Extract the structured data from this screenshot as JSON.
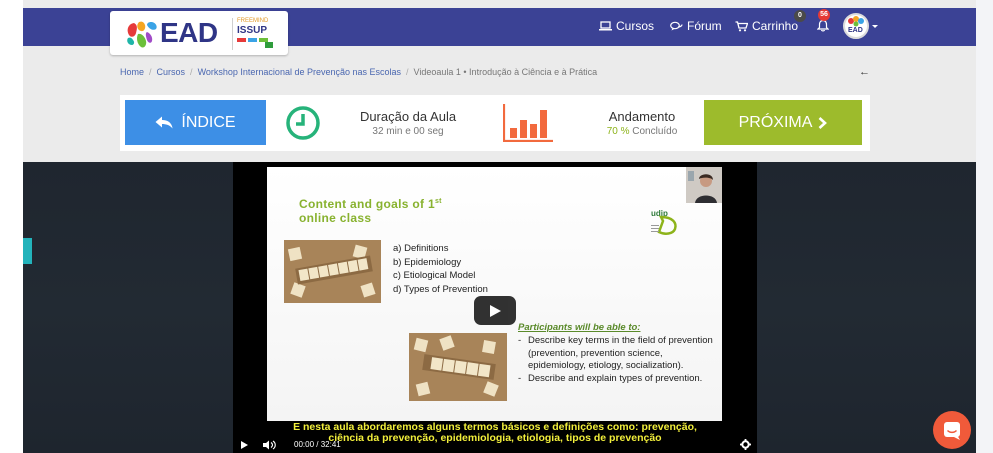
{
  "brand": {
    "logo_text": "EAD",
    "partner_line1": "FREEMIND",
    "partner_line2": "ISSUP"
  },
  "nav": {
    "cursos": "Cursos",
    "forum": "Fórum",
    "carrinho": "Carrinho",
    "cart_count": "0",
    "notification_count": "56",
    "avatar_text": "EAD"
  },
  "breadcrumb": {
    "home": "Home",
    "cursos": "Cursos",
    "workshop": "Workshop Internacional de Prevenção nas Escolas",
    "current": "Videoaula 1 • Introdução à Ciência e à Prática"
  },
  "lesson": {
    "indice_label": "ÍNDICE",
    "duration_title": "Duração da Aula",
    "duration_value": "32 min e 00 seg",
    "progress_title": "Andamento",
    "progress_pct": "70 %",
    "progress_suffix": " Concluído",
    "progress_fraction": 0.7,
    "next_label": "PRÓXIMA"
  },
  "slide": {
    "title_line1": "Content and goals of 1",
    "title_sup": "st",
    "title_line2": "online class",
    "list": [
      "a) Definitions",
      "b) Epidemiology",
      "c) Etiological Model",
      "d) Types of Prevention"
    ],
    "participants_title": "Participants will be able to:",
    "goals": [
      "Describe key terms in the field of prevention (prevention, prevention science, epidemiology, etiology, socialization).",
      "Describe and explain types of prevention."
    ]
  },
  "player": {
    "subtitle_line1": "E nesta aula abordaremos alguns termos básicos e definições como: prevenção,",
    "subtitle_line2": "ciência da prevenção, epidemiologia, etiologia, tipos de prevenção",
    "time_current": "00:00",
    "time_total": "32:41"
  },
  "colors": {
    "navbar": "#3b4295",
    "indice_button": "#3d8fe6",
    "next_button": "#9dbb2c",
    "accent_green": "#8db31a",
    "chart_orange": "#f26a3e",
    "chat_button": "#f05a3a"
  },
  "icons": {
    "cursos": "laptop-icon",
    "forum": "chat-bubbles-icon",
    "carrinho": "cart-icon",
    "notifications": "bell-icon",
    "indice": "back-arrow-icon",
    "duration": "clock-icon",
    "progress": "bar-chart-icon",
    "next": "chevron-right-icon",
    "chat": "chat-icon"
  }
}
